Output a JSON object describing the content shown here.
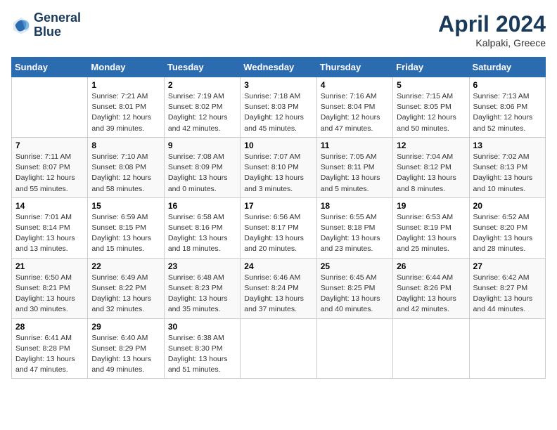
{
  "header": {
    "logo_line1": "General",
    "logo_line2": "Blue",
    "month_title": "April 2024",
    "location": "Kalpaki, Greece"
  },
  "weekdays": [
    "Sunday",
    "Monday",
    "Tuesday",
    "Wednesday",
    "Thursday",
    "Friday",
    "Saturday"
  ],
  "weeks": [
    [
      {
        "day": "",
        "sunrise": "",
        "sunset": "",
        "daylight": ""
      },
      {
        "day": "1",
        "sunrise": "Sunrise: 7:21 AM",
        "sunset": "Sunset: 8:01 PM",
        "daylight": "Daylight: 12 hours and 39 minutes."
      },
      {
        "day": "2",
        "sunrise": "Sunrise: 7:19 AM",
        "sunset": "Sunset: 8:02 PM",
        "daylight": "Daylight: 12 hours and 42 minutes."
      },
      {
        "day": "3",
        "sunrise": "Sunrise: 7:18 AM",
        "sunset": "Sunset: 8:03 PM",
        "daylight": "Daylight: 12 hours and 45 minutes."
      },
      {
        "day": "4",
        "sunrise": "Sunrise: 7:16 AM",
        "sunset": "Sunset: 8:04 PM",
        "daylight": "Daylight: 12 hours and 47 minutes."
      },
      {
        "day": "5",
        "sunrise": "Sunrise: 7:15 AM",
        "sunset": "Sunset: 8:05 PM",
        "daylight": "Daylight: 12 hours and 50 minutes."
      },
      {
        "day": "6",
        "sunrise": "Sunrise: 7:13 AM",
        "sunset": "Sunset: 8:06 PM",
        "daylight": "Daylight: 12 hours and 52 minutes."
      }
    ],
    [
      {
        "day": "7",
        "sunrise": "Sunrise: 7:11 AM",
        "sunset": "Sunset: 8:07 PM",
        "daylight": "Daylight: 12 hours and 55 minutes."
      },
      {
        "day": "8",
        "sunrise": "Sunrise: 7:10 AM",
        "sunset": "Sunset: 8:08 PM",
        "daylight": "Daylight: 12 hours and 58 minutes."
      },
      {
        "day": "9",
        "sunrise": "Sunrise: 7:08 AM",
        "sunset": "Sunset: 8:09 PM",
        "daylight": "Daylight: 13 hours and 0 minutes."
      },
      {
        "day": "10",
        "sunrise": "Sunrise: 7:07 AM",
        "sunset": "Sunset: 8:10 PM",
        "daylight": "Daylight: 13 hours and 3 minutes."
      },
      {
        "day": "11",
        "sunrise": "Sunrise: 7:05 AM",
        "sunset": "Sunset: 8:11 PM",
        "daylight": "Daylight: 13 hours and 5 minutes."
      },
      {
        "day": "12",
        "sunrise": "Sunrise: 7:04 AM",
        "sunset": "Sunset: 8:12 PM",
        "daylight": "Daylight: 13 hours and 8 minutes."
      },
      {
        "day": "13",
        "sunrise": "Sunrise: 7:02 AM",
        "sunset": "Sunset: 8:13 PM",
        "daylight": "Daylight: 13 hours and 10 minutes."
      }
    ],
    [
      {
        "day": "14",
        "sunrise": "Sunrise: 7:01 AM",
        "sunset": "Sunset: 8:14 PM",
        "daylight": "Daylight: 13 hours and 13 minutes."
      },
      {
        "day": "15",
        "sunrise": "Sunrise: 6:59 AM",
        "sunset": "Sunset: 8:15 PM",
        "daylight": "Daylight: 13 hours and 15 minutes."
      },
      {
        "day": "16",
        "sunrise": "Sunrise: 6:58 AM",
        "sunset": "Sunset: 8:16 PM",
        "daylight": "Daylight: 13 hours and 18 minutes."
      },
      {
        "day": "17",
        "sunrise": "Sunrise: 6:56 AM",
        "sunset": "Sunset: 8:17 PM",
        "daylight": "Daylight: 13 hours and 20 minutes."
      },
      {
        "day": "18",
        "sunrise": "Sunrise: 6:55 AM",
        "sunset": "Sunset: 8:18 PM",
        "daylight": "Daylight: 13 hours and 23 minutes."
      },
      {
        "day": "19",
        "sunrise": "Sunrise: 6:53 AM",
        "sunset": "Sunset: 8:19 PM",
        "daylight": "Daylight: 13 hours and 25 minutes."
      },
      {
        "day": "20",
        "sunrise": "Sunrise: 6:52 AM",
        "sunset": "Sunset: 8:20 PM",
        "daylight": "Daylight: 13 hours and 28 minutes."
      }
    ],
    [
      {
        "day": "21",
        "sunrise": "Sunrise: 6:50 AM",
        "sunset": "Sunset: 8:21 PM",
        "daylight": "Daylight: 13 hours and 30 minutes."
      },
      {
        "day": "22",
        "sunrise": "Sunrise: 6:49 AM",
        "sunset": "Sunset: 8:22 PM",
        "daylight": "Daylight: 13 hours and 32 minutes."
      },
      {
        "day": "23",
        "sunrise": "Sunrise: 6:48 AM",
        "sunset": "Sunset: 8:23 PM",
        "daylight": "Daylight: 13 hours and 35 minutes."
      },
      {
        "day": "24",
        "sunrise": "Sunrise: 6:46 AM",
        "sunset": "Sunset: 8:24 PM",
        "daylight": "Daylight: 13 hours and 37 minutes."
      },
      {
        "day": "25",
        "sunrise": "Sunrise: 6:45 AM",
        "sunset": "Sunset: 8:25 PM",
        "daylight": "Daylight: 13 hours and 40 minutes."
      },
      {
        "day": "26",
        "sunrise": "Sunrise: 6:44 AM",
        "sunset": "Sunset: 8:26 PM",
        "daylight": "Daylight: 13 hours and 42 minutes."
      },
      {
        "day": "27",
        "sunrise": "Sunrise: 6:42 AM",
        "sunset": "Sunset: 8:27 PM",
        "daylight": "Daylight: 13 hours and 44 minutes."
      }
    ],
    [
      {
        "day": "28",
        "sunrise": "Sunrise: 6:41 AM",
        "sunset": "Sunset: 8:28 PM",
        "daylight": "Daylight: 13 hours and 47 minutes."
      },
      {
        "day": "29",
        "sunrise": "Sunrise: 6:40 AM",
        "sunset": "Sunset: 8:29 PM",
        "daylight": "Daylight: 13 hours and 49 minutes."
      },
      {
        "day": "30",
        "sunrise": "Sunrise: 6:38 AM",
        "sunset": "Sunset: 8:30 PM",
        "daylight": "Daylight: 13 hours and 51 minutes."
      },
      {
        "day": "",
        "sunrise": "",
        "sunset": "",
        "daylight": ""
      },
      {
        "day": "",
        "sunrise": "",
        "sunset": "",
        "daylight": ""
      },
      {
        "day": "",
        "sunrise": "",
        "sunset": "",
        "daylight": ""
      },
      {
        "day": "",
        "sunrise": "",
        "sunset": "",
        "daylight": ""
      }
    ]
  ]
}
